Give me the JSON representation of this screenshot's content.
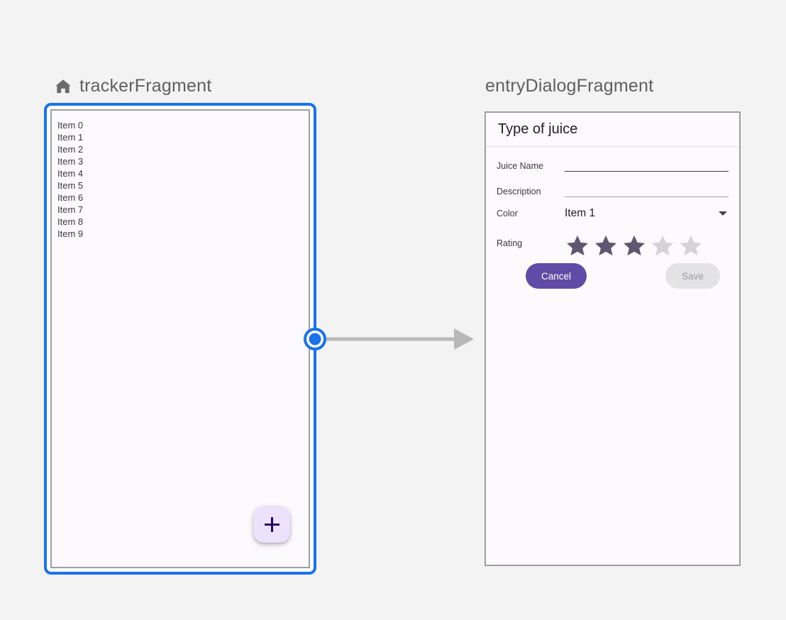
{
  "canvas": {
    "background_color": "#f3f3f3"
  },
  "destinations": [
    {
      "id": "trackerFragment",
      "label": "trackerFragment",
      "icon": "home-icon",
      "selected": true,
      "selection_color": "#1a73e8",
      "screen": {
        "list_items": [
          "Item 0",
          "Item 1",
          "Item 2",
          "Item 3",
          "Item 4",
          "Item 5",
          "Item 6",
          "Item 7",
          "Item 8",
          "Item 9"
        ],
        "fab": {
          "icon": "plus-icon",
          "background_color": "#ede2fb",
          "icon_color": "#23016b"
        }
      }
    },
    {
      "id": "entryDialogFragment",
      "label": "entryDialogFragment",
      "selected": false,
      "screen": {
        "title": "Type of juice",
        "fields": [
          {
            "label": "Juice Name",
            "value": "",
            "type": "text",
            "focused": true
          },
          {
            "label": "Description",
            "value": "",
            "type": "text",
            "focused": false
          },
          {
            "label": "Color",
            "value": "Item 1",
            "type": "spinner"
          },
          {
            "label": "Rating",
            "type": "rating",
            "value": 3,
            "max": 5
          }
        ],
        "rating": {
          "filled": 3,
          "total": 5,
          "filled_color": "#5f5772",
          "empty_color": "#d5d2d8"
        },
        "buttons": {
          "cancel_label": "Cancel",
          "cancel_color": "#604ba6",
          "save_label": "Save",
          "save_color": "#e3e2e4",
          "save_enabled": false
        }
      }
    }
  ],
  "action": {
    "from": "trackerFragment",
    "to": "entryDialogFragment",
    "line_color": "#b8b8b8",
    "handle_color": "#1a73e8"
  }
}
